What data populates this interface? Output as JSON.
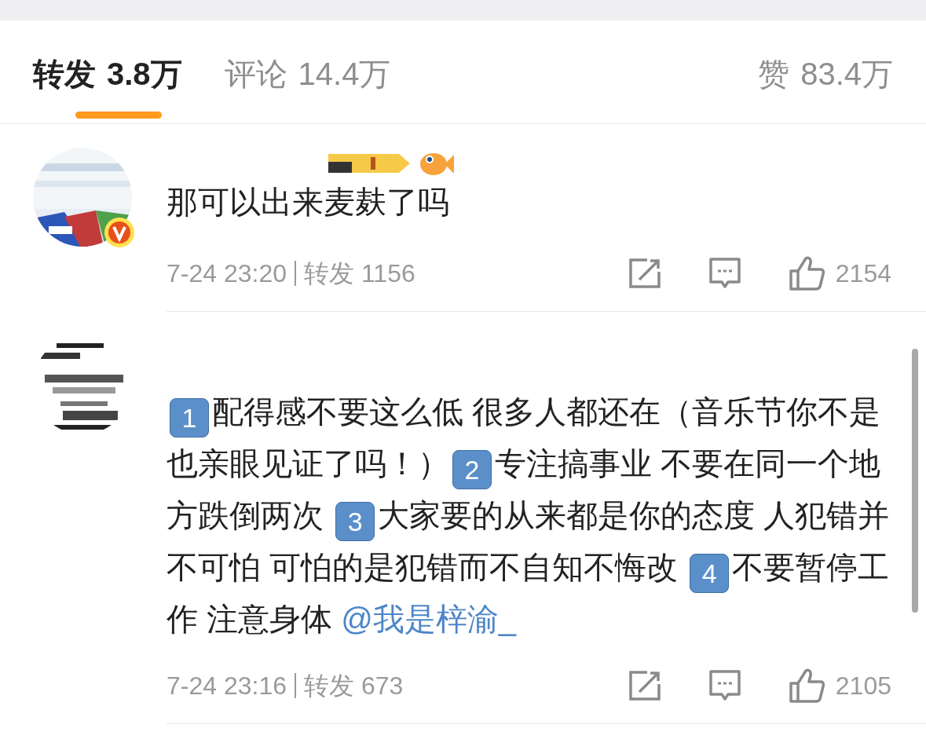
{
  "tabs": [
    {
      "label": "转发",
      "count": "3.8万",
      "selected": true
    },
    {
      "label": "评论",
      "count": "14.4万",
      "selected": false
    },
    {
      "label": "赞",
      "count": "83.4万",
      "selected": false
    }
  ],
  "comments": [
    {
      "verified": true,
      "badges": true,
      "segments": [
        {
          "kind": "text",
          "text": "那可以出来麦麸了吗"
        }
      ],
      "time": "7-24 23:20",
      "reposts": "转发 1156",
      "likes": "2154"
    },
    {
      "verified": false,
      "badges": false,
      "segments": [
        {
          "kind": "keycap",
          "text": "1"
        },
        {
          "kind": "text",
          "text": "配得感不要这么低 很多人都还在（音乐节你不是也亲眼见证了吗！）"
        },
        {
          "kind": "keycap",
          "text": "2"
        },
        {
          "kind": "text",
          "text": "专注搞事业 不要在同一个地方跌倒两次 "
        },
        {
          "kind": "keycap",
          "text": "3"
        },
        {
          "kind": "text",
          "text": "大家要的从来都是你的态度 人犯错并不可怕 可怕的是犯错而不自知不悔改 "
        },
        {
          "kind": "keycap",
          "text": "4"
        },
        {
          "kind": "text",
          "text": "不要暂停工作 注意身体 "
        },
        {
          "kind": "mention",
          "text": "@我是梓渝_"
        }
      ],
      "time": "7-24 23:16",
      "reposts": "转发 673",
      "likes": "2105"
    }
  ]
}
